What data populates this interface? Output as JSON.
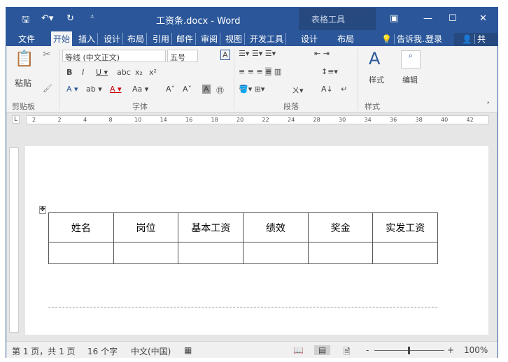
{
  "titlebar": {
    "title": "工资条.docx - Word",
    "context_tab": "表格工具",
    "save_icon": "save-icon",
    "undo_icon": "undo-icon",
    "redo_icon": "redo-icon"
  },
  "tabs": [
    {
      "label": "文件"
    },
    {
      "label": "开始",
      "active": true
    },
    {
      "label": "插入"
    },
    {
      "label": "设计"
    },
    {
      "label": "布局"
    },
    {
      "label": "引用"
    },
    {
      "label": "邮件"
    },
    {
      "label": "审阅"
    },
    {
      "label": "视图"
    },
    {
      "label": "开发工具"
    },
    {
      "label": "设计"
    },
    {
      "label": "布局"
    }
  ],
  "tell_me": "告诉我...",
  "login": "登录",
  "share": "共享",
  "ribbon": {
    "paste": "粘贴",
    "font_name": "等线 (中文正文)",
    "font_size": "五号",
    "styles": "样式",
    "edit": "编辑",
    "groups": [
      "剪贴板",
      "字体",
      "段落",
      "样式"
    ]
  },
  "ruler_ticks": [
    "2",
    "2",
    "4",
    "8",
    "10",
    "14",
    "16",
    "18",
    "20",
    "22",
    "24",
    "28",
    "30",
    "34",
    "36",
    "38",
    "40",
    "42"
  ],
  "table": {
    "headers": [
      "姓名",
      "岗位",
      "基本工资",
      "绩效",
      "奖金",
      "实发工资"
    ],
    "rows": [
      [
        "",
        "",
        "",
        "",
        "",
        ""
      ]
    ]
  },
  "status": {
    "page": "第 1 页，共 1 页",
    "words": "16 个字",
    "language": "中文(中国)",
    "zoom": "100%",
    "zoom_level_percent": 100
  },
  "colors": {
    "accent": "#2b579a"
  }
}
